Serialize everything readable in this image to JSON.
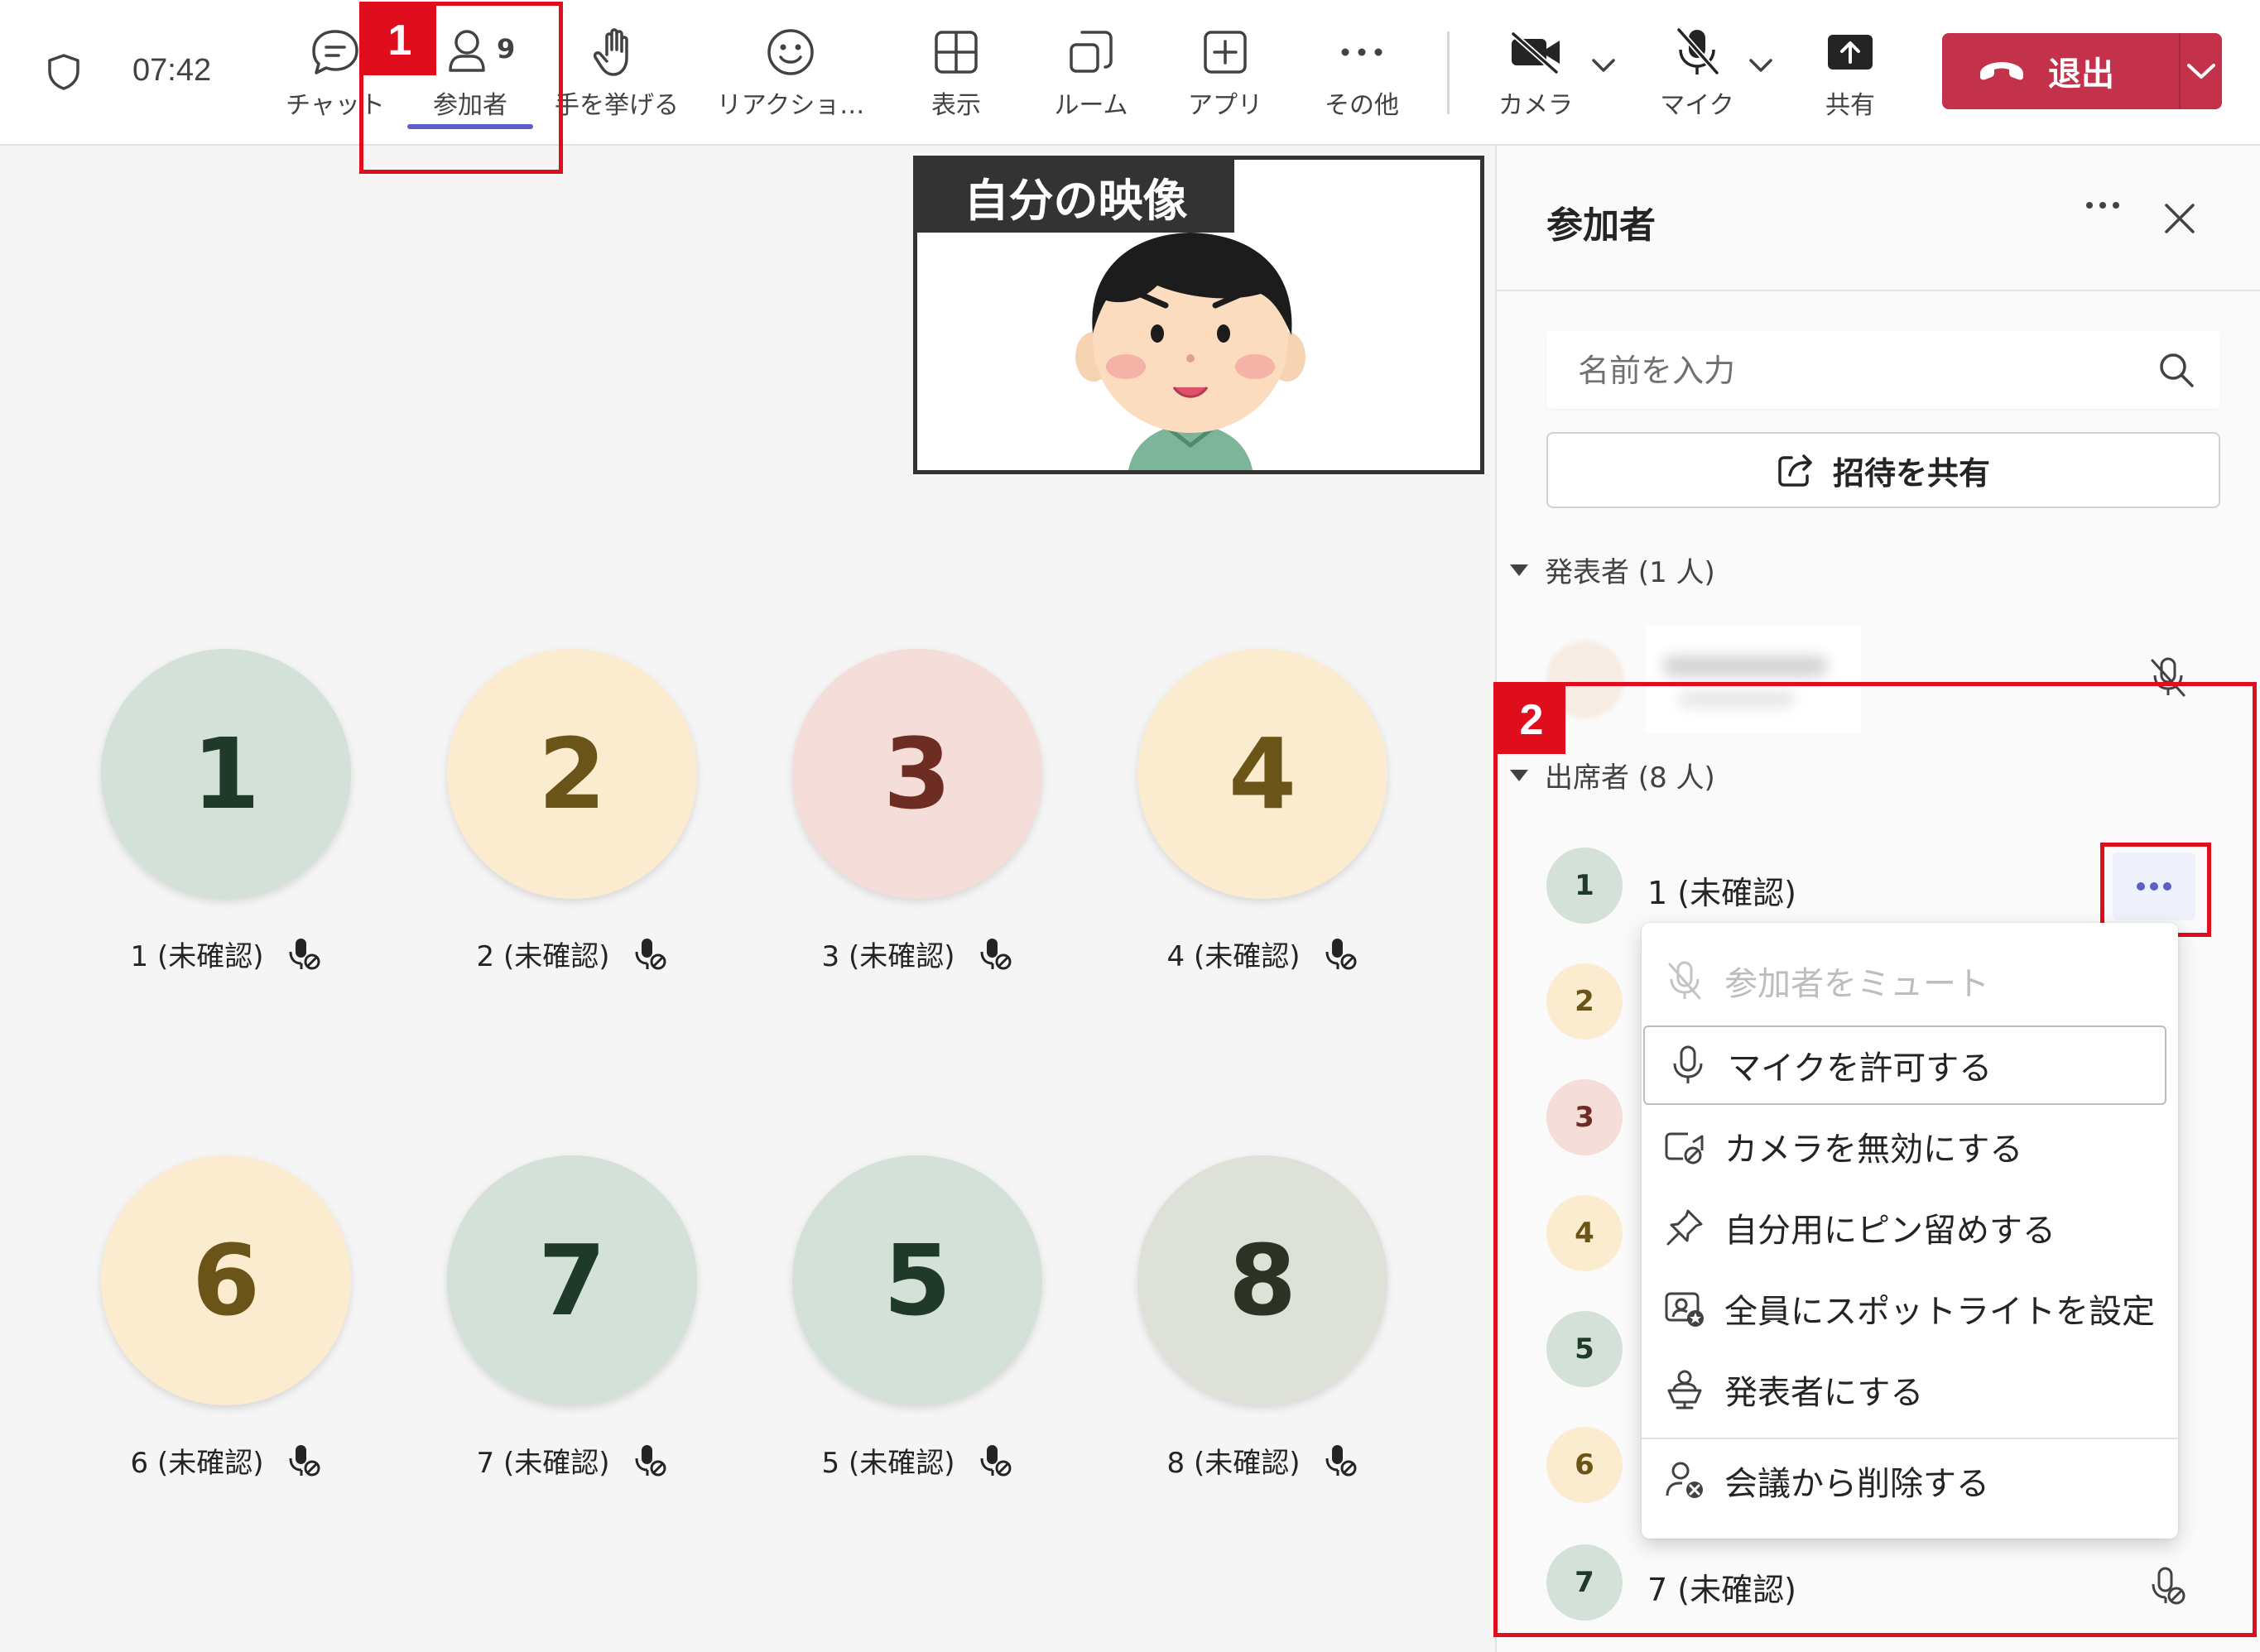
{
  "header": {
    "time": "07:42",
    "participant_count": "9",
    "toolbar": [
      {
        "id": "chat",
        "label": "チャット",
        "icon": "chat-icon"
      },
      {
        "id": "participants",
        "label": "参加者",
        "icon": "people-icon"
      },
      {
        "id": "raise_hand",
        "label": "手を挙げる",
        "icon": "hand-icon"
      },
      {
        "id": "reactions",
        "label": "リアクショ…",
        "icon": "smile-icon"
      },
      {
        "id": "view",
        "label": "表示",
        "icon": "grid-icon"
      },
      {
        "id": "rooms",
        "label": "ルーム",
        "icon": "rooms-icon"
      },
      {
        "id": "apps",
        "label": "アプリ",
        "icon": "plus-icon"
      },
      {
        "id": "more",
        "label": "その他",
        "icon": "ellipsis-icon"
      },
      {
        "id": "camera",
        "label": "カメラ",
        "icon": "camera-off-icon"
      },
      {
        "id": "mic",
        "label": "マイク",
        "icon": "mic-off-icon"
      },
      {
        "id": "share",
        "label": "共有",
        "icon": "share-icon"
      }
    ],
    "leave_label": "退出"
  },
  "annotations": {
    "badge1": "1",
    "badge2": "2"
  },
  "self_video": {
    "caption": "自分の映像"
  },
  "grid": {
    "tiles": [
      {
        "num": "1",
        "label": "1 (未確認)",
        "bg": "#d3e1d9",
        "fg": "#1f3a29"
      },
      {
        "num": "2",
        "label": "2 (未確認)",
        "bg": "#fbeccf",
        "fg": "#6b5418"
      },
      {
        "num": "3",
        "label": "3 (未確認)",
        "bg": "#f5ddd9",
        "fg": "#6e2d22"
      },
      {
        "num": "4",
        "label": "4 (未確認)",
        "bg": "#fbeccf",
        "fg": "#6b5418"
      },
      {
        "num": "6",
        "label": "6 (未確認)",
        "bg": "#fbeccf",
        "fg": "#6b5418"
      },
      {
        "num": "7",
        "label": "7 (未確認)",
        "bg": "#d3e1d9",
        "fg": "#1f3a29"
      },
      {
        "num": "5",
        "label": "5 (未確認)",
        "bg": "#d3e1d9",
        "fg": "#1f3a29"
      },
      {
        "num": "8",
        "label": "8 (未確認)",
        "bg": "#dde1d8",
        "fg": "#2c3324"
      }
    ]
  },
  "panel": {
    "title": "参加者",
    "search_placeholder": "名前を入力",
    "invite_label": "招待を共有",
    "presenters_header": "発表者 (1 人)",
    "attendees_header": "出席者 (8 人)",
    "attendees": [
      {
        "num": "1",
        "name": "1 (未確認)",
        "bg": "#d3e1d9",
        "fg": "#1f3a29"
      },
      {
        "num": "2",
        "name": "",
        "bg": "#fbeccf",
        "fg": "#6b5418"
      },
      {
        "num": "3",
        "name": "",
        "bg": "#f5ddd9",
        "fg": "#6e2d22"
      },
      {
        "num": "4",
        "name": "",
        "bg": "#fbeccf",
        "fg": "#6b5418"
      },
      {
        "num": "5",
        "name": "",
        "bg": "#d3e1d9",
        "fg": "#1f3a29"
      },
      {
        "num": "6",
        "name": "",
        "bg": "#fbeccf",
        "fg": "#6b5418"
      },
      {
        "num": "7",
        "name": "7 (未確認)",
        "bg": "#d3e1d9",
        "fg": "#1f3a29"
      }
    ]
  },
  "context_menu": {
    "items": [
      {
        "label": "参加者をミュート",
        "icon": "mic-off-icon",
        "disabled": true
      },
      {
        "label": "マイクを許可する",
        "icon": "mic-icon"
      },
      {
        "label": "カメラを無効にする",
        "icon": "camera-off-icon"
      },
      {
        "label": "自分用にピン留めする",
        "icon": "pin-icon"
      },
      {
        "label": "全員にスポットライトを設定",
        "icon": "spotlight-icon"
      },
      {
        "label": "発表者にする",
        "icon": "presenter-icon"
      },
      {
        "label": "会議から削除する",
        "icon": "remove-person-icon"
      }
    ]
  },
  "colors": {
    "accent": "#5b5fc7",
    "leave": "#c4314b",
    "annotation": "#e00d1d"
  }
}
